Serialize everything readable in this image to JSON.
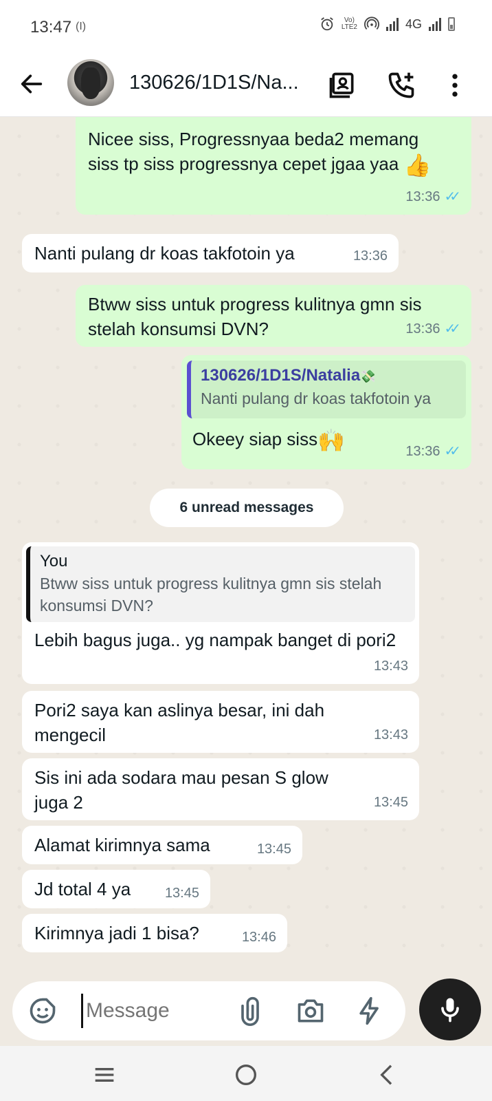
{
  "status_bar": {
    "time": "13:47",
    "vibrate_glyph": "(I)",
    "lte_top": "Vo)",
    "lte_bottom": "LTE2",
    "network": "4G",
    "icons": [
      "alarm-icon",
      "hotspot-icon",
      "signal-icon",
      "battery-icon"
    ]
  },
  "header": {
    "title": "130626/1D1S/Na...",
    "icons": [
      "back-arrow-icon",
      "contact-card-icon",
      "add-call-icon",
      "more-vert-icon"
    ]
  },
  "messages": [
    {
      "dir": "out",
      "text": "Nicee siss, Progressnyaa beda2 memang siss tp siss progressnya cepet jgaa yaa",
      "emoji": "👍",
      "time": "13:36",
      "read": true
    },
    {
      "dir": "in",
      "text": "Nanti pulang dr koas takfotoin ya",
      "time": "13:36"
    },
    {
      "dir": "out",
      "text": "Btww siss untuk progress kulitnya gmn sis stelah konsumsi DVN?",
      "time": "13:36",
      "read": true
    },
    {
      "dir": "out",
      "reply_to": {
        "name": "130626/1D1S/Natalia",
        "name_emoji": "💸",
        "text": "Nanti pulang dr koas takfotoin ya"
      },
      "text": "Okeey siap siss",
      "emoji": "🙌",
      "time": "13:36",
      "read": true
    },
    {
      "dir": "in",
      "reply_to": {
        "name": "You",
        "text": "Btww siss untuk progress kulitnya gmn sis stelah konsumsi DVN?"
      },
      "text": "Lebih bagus juga.. yg nampak banget di pori2",
      "time": "13:43"
    },
    {
      "dir": "in",
      "text": "Pori2 saya kan aslinya besar, ini dah mengecil",
      "time": "13:43"
    },
    {
      "dir": "in",
      "text": "Sis ini ada sodara mau pesan S glow juga 2",
      "time": "13:45"
    },
    {
      "dir": "in",
      "text": "Alamat kirimnya sama",
      "time": "13:45"
    },
    {
      "dir": "in",
      "text": "Jd total 4 ya",
      "time": "13:45"
    },
    {
      "dir": "in",
      "text": "Kirimnya jadi 1 bisa?",
      "time": "13:46"
    }
  ],
  "unread_divider": "6 unread messages",
  "composer": {
    "placeholder": "Message",
    "icons": [
      "emoji-sticker-icon",
      "attach-icon",
      "camera-icon",
      "payment-bolt-icon",
      "mic-icon"
    ]
  },
  "nav": {
    "icons": [
      "recents-icon",
      "home-icon",
      "back-icon"
    ]
  },
  "colors": {
    "outgoing_bubble": "#d9fdd3",
    "incoming_bubble": "#ffffff",
    "chat_background": "#efeae2",
    "read_ticks": "#53bdeb",
    "reply_bar_contact": "#5b4fd1",
    "reply_bar_you": "#111111"
  }
}
